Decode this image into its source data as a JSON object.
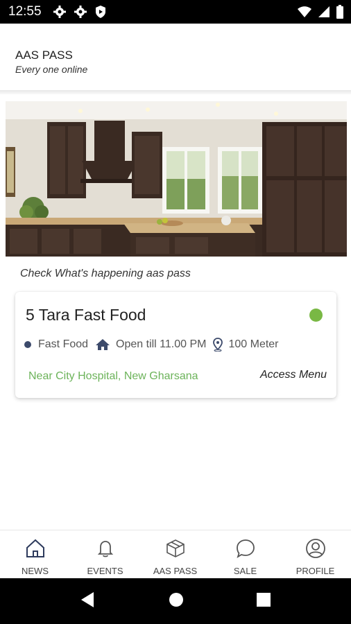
{
  "status_bar": {
    "time": "12:55",
    "left_icons": [
      "gear-icon",
      "gear-icon",
      "shield-icon"
    ],
    "right_icons": [
      "wifi-icon",
      "signal-icon",
      "battery-icon"
    ]
  },
  "header": {
    "title": "AAS PASS",
    "subtitle": "Every one online"
  },
  "hero": {
    "image": "kitchen-photo"
  },
  "feed": {
    "caption": "Check What's happening aas pass"
  },
  "card": {
    "name": "5 Tara Fast Food",
    "status_color": "#79b844",
    "category": "Fast Food",
    "hours": "Open till  11.00 PM",
    "distance": "100 Meter",
    "address": "Near City Hospital, New Gharsana",
    "action": "Access Menu"
  },
  "bottom_nav": {
    "items": [
      {
        "label": "NEWS",
        "icon": "home-icon"
      },
      {
        "label": "EVENTS",
        "icon": "bell-icon"
      },
      {
        "label": "AAS PASS",
        "icon": "box-icon"
      },
      {
        "label": "SALE",
        "icon": "chat-bubble-icon"
      },
      {
        "label": "PROFILE",
        "icon": "user-circle-icon"
      }
    ]
  },
  "colors": {
    "accent_green": "#6cb35a",
    "dot_navy": "#3c4a6b"
  }
}
